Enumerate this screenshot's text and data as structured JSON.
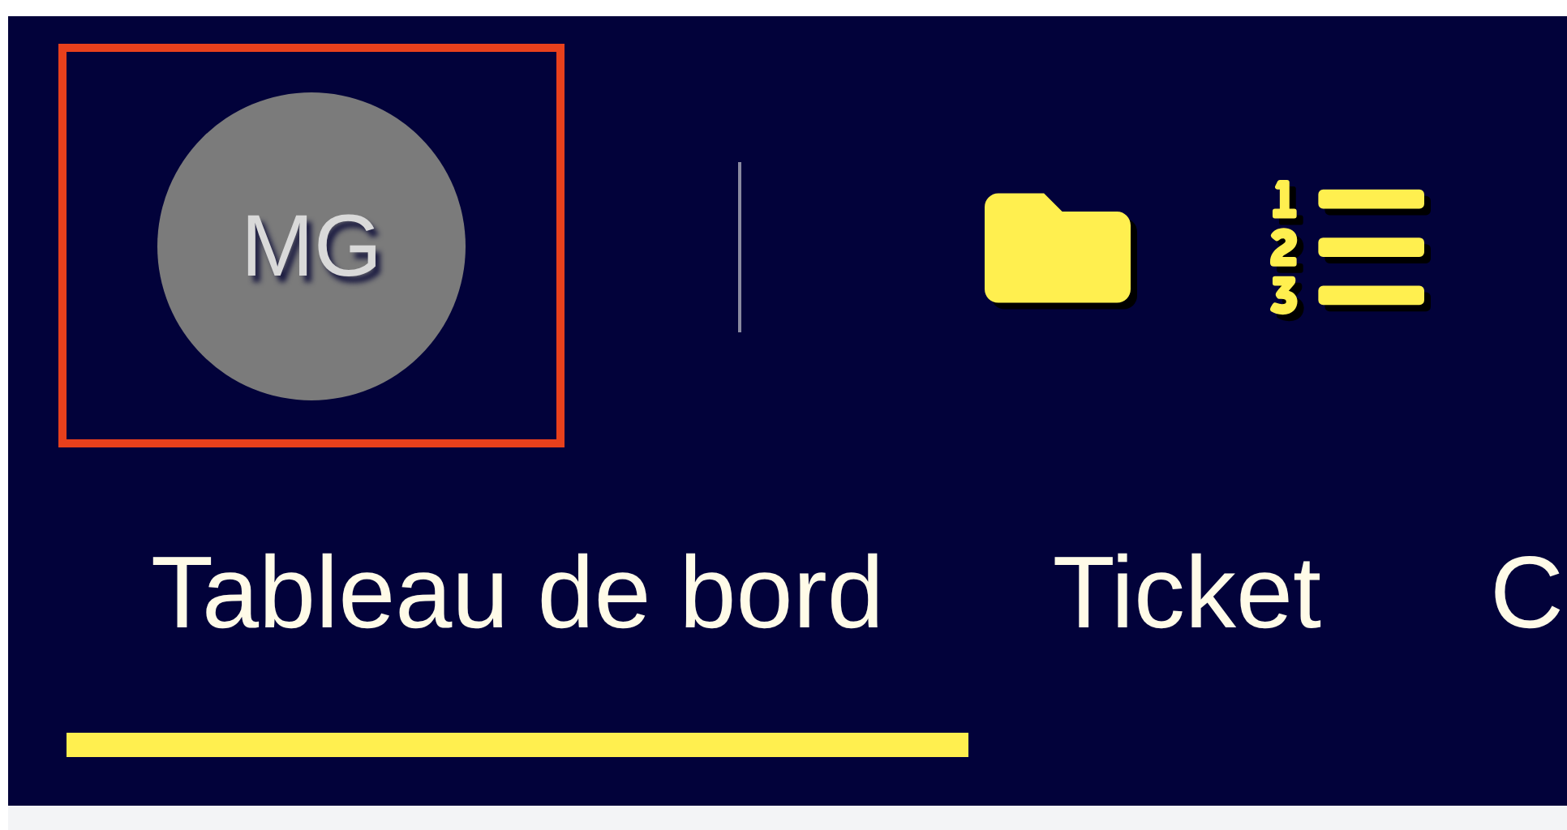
{
  "header": {
    "avatar": {
      "initials": "MG",
      "focused": true
    }
  },
  "tabs": [
    {
      "label": "Tableau de bord",
      "selected": true
    },
    {
      "label": "Ticket",
      "selected": false
    },
    {
      "label": "C",
      "selected": false
    }
  ]
}
